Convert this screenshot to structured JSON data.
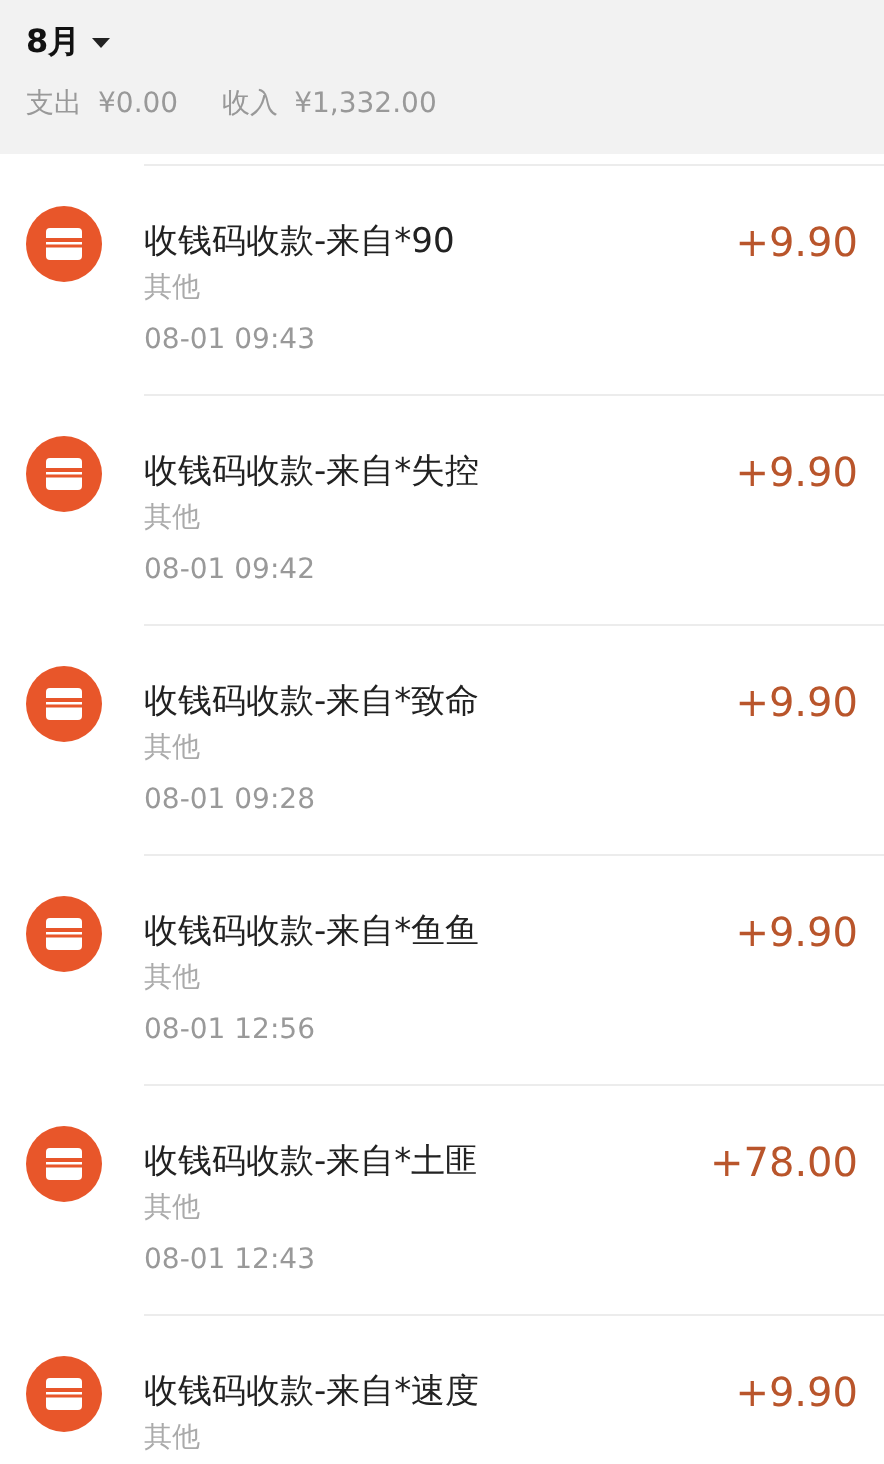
{
  "header": {
    "month": "8月",
    "expense_label": "支出",
    "expense": "¥0.00",
    "income_label": "收入",
    "income": "¥1,332.00"
  },
  "transactions": [
    {
      "title": "收钱码收款-来自*90",
      "category": "其他",
      "time": "08-01 09:43",
      "amount": "+9.90"
    },
    {
      "title": "收钱码收款-来自*失控",
      "category": "其他",
      "time": "08-01 09:42",
      "amount": "+9.90"
    },
    {
      "title": "收钱码收款-来自*致命",
      "category": "其他",
      "time": "08-01 09:28",
      "amount": "+9.90"
    },
    {
      "title": "收钱码收款-来自*鱼鱼",
      "category": "其他",
      "time": "08-01 12:56",
      "amount": "+9.90"
    },
    {
      "title": "收钱码收款-来自*土匪",
      "category": "其他",
      "time": "08-01 12:43",
      "amount": "+78.00"
    },
    {
      "title": "收钱码收款-来自*速度",
      "category": "其他",
      "amount": "+9.90"
    }
  ]
}
